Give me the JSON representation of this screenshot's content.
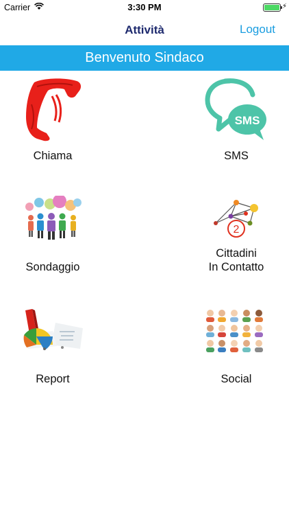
{
  "status_bar": {
    "carrier": "Carrier",
    "time": "3:30 PM",
    "battery_level": 1.0
  },
  "nav": {
    "title": "Attività",
    "logout_label": "Logout"
  },
  "banner": {
    "text": "Benvenuto Sindaco",
    "color": "#20a9e6"
  },
  "tiles": [
    {
      "label": "Chiama",
      "icon": "phone-handset-icon"
    },
    {
      "label": "SMS",
      "icon": "sms-bubbles-icon",
      "badge_text": "SMS"
    },
    {
      "label": "Sondaggio",
      "icon": "poll-people-icon"
    },
    {
      "label_line1": "Cittadini",
      "label_line2": "In Contatto",
      "icon": "network-icon",
      "badge_text": "2"
    },
    {
      "label": "Report",
      "icon": "report-chart-icon"
    },
    {
      "label": "Social",
      "icon": "social-faces-icon"
    }
  ]
}
